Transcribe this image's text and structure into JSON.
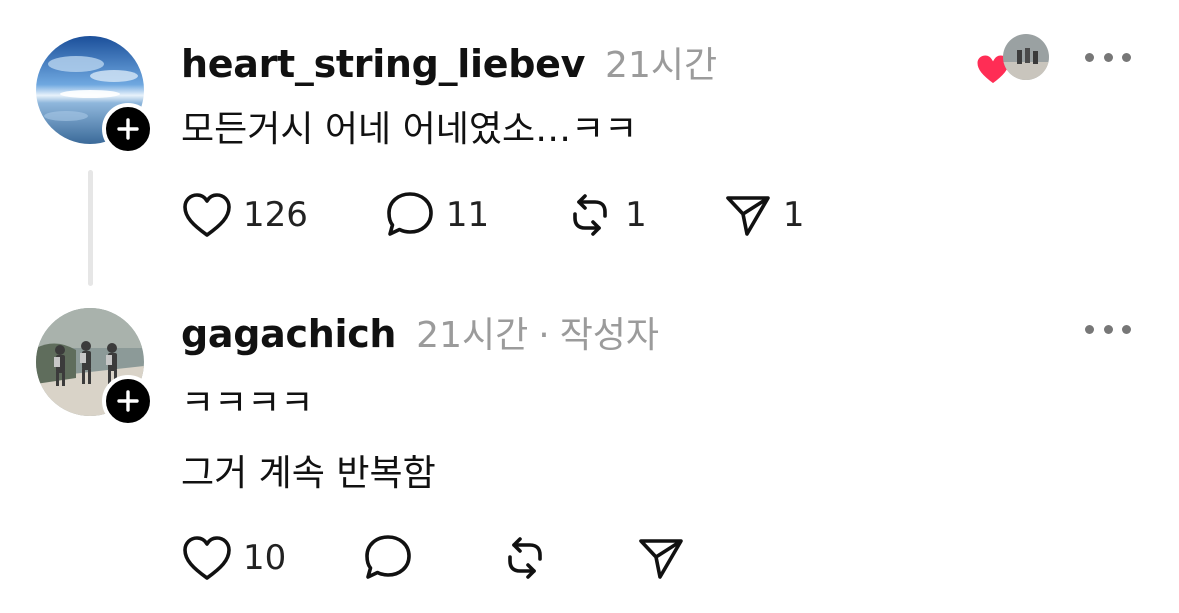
{
  "colors": {
    "text": "#111111",
    "muted": "#9b9b9b",
    "heart": "#ff2d55",
    "thread_line": "#e6e6e6"
  },
  "replies": [
    {
      "username": "heart_string_liebev",
      "time": "21시간",
      "author_tag": "",
      "lines": [
        "모든거시 어네 어네였소…ㅋㅋ"
      ],
      "likes": "126",
      "comments": "11",
      "reposts": "1",
      "shares": "1",
      "liked_by_author": true,
      "avatar_icon": "sky-photo",
      "follow_icon": "plus-icon"
    },
    {
      "username": "gagachich",
      "time": "21시간",
      "author_tag": "작성자",
      "separator": "·",
      "lines": [
        "ㅋㅋㅋㅋ",
        "그거 계속 반복함"
      ],
      "likes": "10",
      "comments": "",
      "reposts": "",
      "shares": "",
      "avatar_icon": "kids-walking-photo",
      "follow_icon": "plus-icon"
    }
  ]
}
